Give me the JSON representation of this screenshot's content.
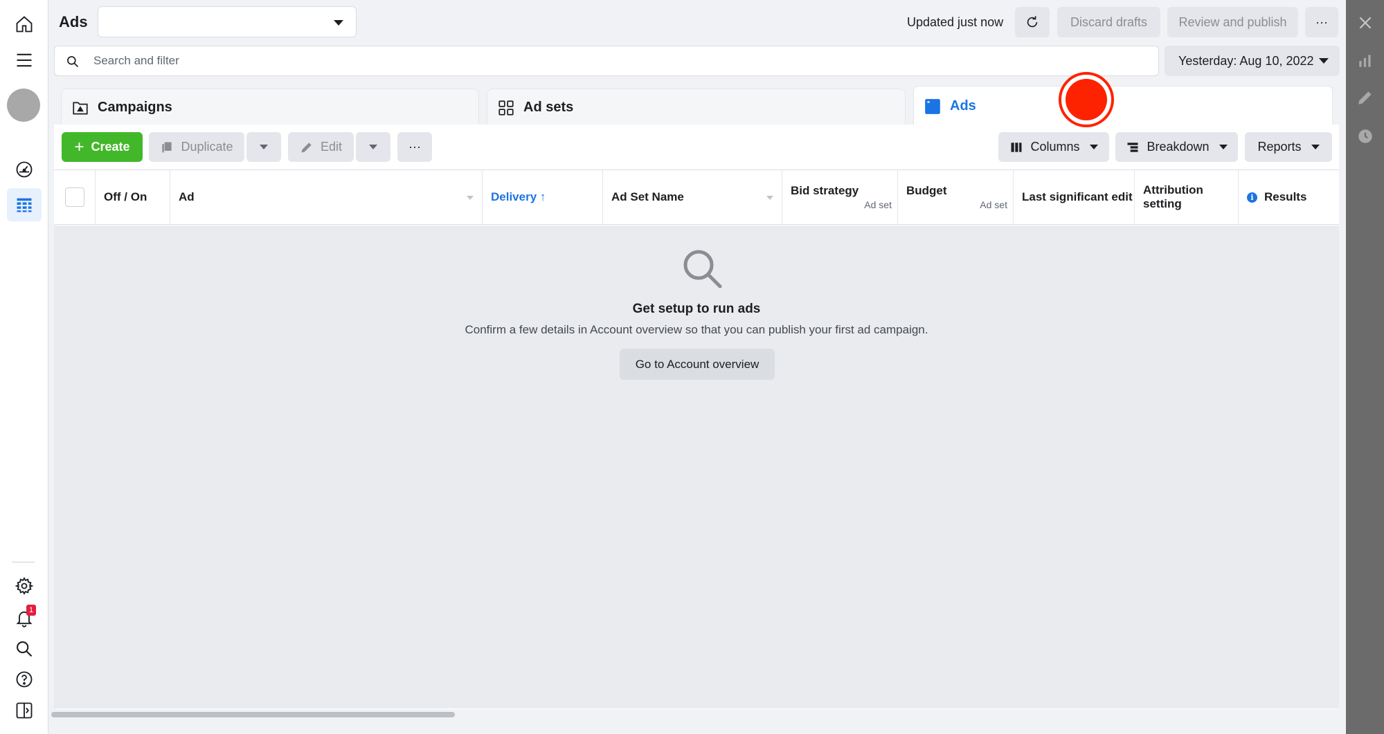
{
  "header": {
    "title": "Ads",
    "account_value": "",
    "updated_text": "Updated just now",
    "discard_label": "Discard drafts",
    "review_label": "Review and publish",
    "more_label": "···"
  },
  "search": {
    "placeholder": "Search and filter"
  },
  "date_range": {
    "label": "Yesterday: Aug 10, 2022"
  },
  "tabs": [
    {
      "label": "Campaigns",
      "active": false
    },
    {
      "label": "Ad sets",
      "active": false
    },
    {
      "label": "Ads",
      "active": true
    }
  ],
  "toolbar": {
    "create_label": "Create",
    "duplicate_label": "Duplicate",
    "edit_label": "Edit",
    "more_label": "···",
    "columns_label": "Columns",
    "breakdown_label": "Breakdown",
    "reports_label": "Reports"
  },
  "table": {
    "columns": [
      {
        "label": "Off / On"
      },
      {
        "label": "Ad"
      },
      {
        "label": "Delivery ↑"
      },
      {
        "label": "Ad Set Name"
      },
      {
        "label": "Bid strategy",
        "sub": "Ad set"
      },
      {
        "label": "Budget",
        "sub": "Ad set"
      },
      {
        "label": "Last significant edit"
      },
      {
        "label": "Attribution setting"
      },
      {
        "label": "Results"
      }
    ]
  },
  "empty_state": {
    "title": "Get setup to run ads",
    "text": "Confirm a few details in Account overview so that you can publish your first ad campaign.",
    "button_label": "Go to Account overview"
  },
  "left_nav": {
    "notification_count": "1"
  },
  "colors": {
    "accent": "#1b74e4",
    "create": "#42b72a",
    "badge": "#e41e3f",
    "recording": "#fd2200"
  }
}
